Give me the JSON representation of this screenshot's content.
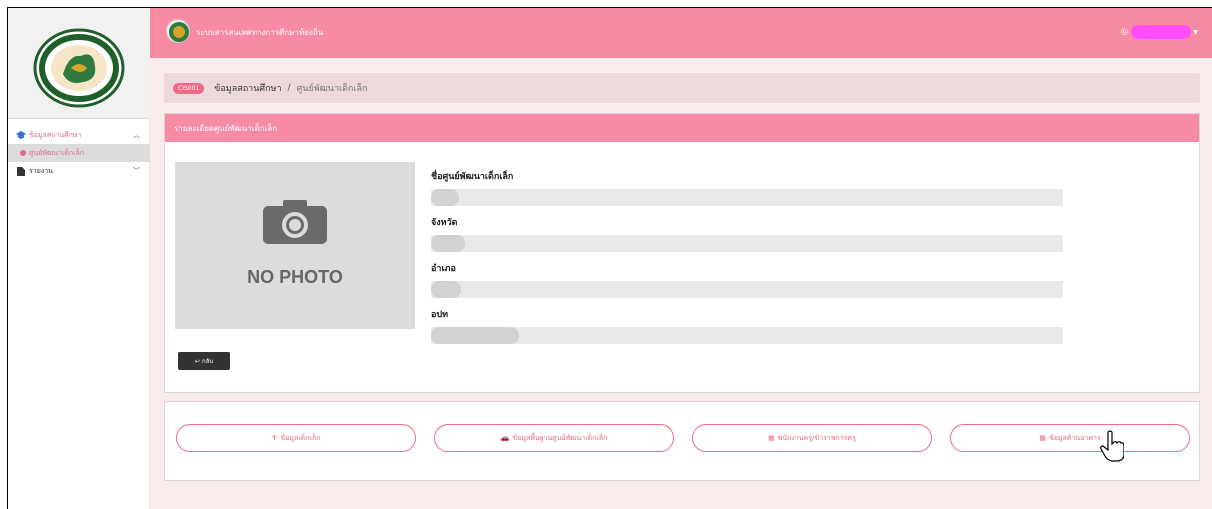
{
  "header": {
    "title": "ระบบสารสนเทศทางการศึกษาท้องถิ่น",
    "user_icon": "user-circle-icon"
  },
  "sidebar": {
    "items": [
      {
        "label": "ข้อมูลสถานศึกษา",
        "icon": "graduation-cap-icon",
        "expanded": true
      },
      {
        "label": "ศูนย์พัฒนาเด็กเล็ก",
        "icon": "dot-icon",
        "active": true
      },
      {
        "label": "รายงาน",
        "icon": "file-icon",
        "expanded": false
      }
    ]
  },
  "breadcrumb": {
    "code": "CIS001",
    "section": "ข้อมูลสถานศึกษา",
    "separator": "/",
    "current": "ศูนย์พัฒนาเด็กเล็ก"
  },
  "detail_card": {
    "title": "รายละเอียดศูนย์พัฒนาเด็กเล็ก",
    "photo_text": "NO PHOTO",
    "fields": [
      {
        "label": "ชื่อศูนย์พัฒนาเด็กเล็ก"
      },
      {
        "label": "จังหวัด"
      },
      {
        "label": "อำเภอ"
      },
      {
        "label": "อปท"
      }
    ],
    "back_label": "กลับ"
  },
  "actions": [
    {
      "label": "ข้อมูลเด็กเล็ก",
      "icon": "child-icon"
    },
    {
      "label": "ข้อมูลพื้นฐานศูนย์พัฒนาเด็กเล็ก",
      "icon": "car-icon"
    },
    {
      "label": "พนักงานครู/ข้าราชการครู",
      "icon": "building-icon"
    },
    {
      "label": "ข้อมูลด้านอาคาร",
      "icon": "building-icon"
    }
  ],
  "colors": {
    "header_pink": "#f78ba3",
    "accent": "#ef6a86",
    "content_bg": "#f8eced"
  }
}
